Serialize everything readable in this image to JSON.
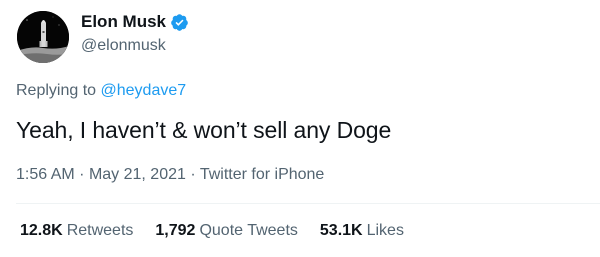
{
  "user": {
    "display_name": "Elon Musk",
    "handle": "@elonmusk",
    "verified": true
  },
  "reply": {
    "prefix": "Replying to",
    "to_handle": "@heydave7"
  },
  "tweet": {
    "text": "Yeah, I haven’t & won’t sell any Doge"
  },
  "meta": {
    "time": "1:56 AM",
    "separator": "·",
    "date": "May 21, 2021",
    "source": "Twitter for iPhone"
  },
  "stats": {
    "retweets_count": "12.8K",
    "retweets_label": "Retweets",
    "quotes_count": "1,792",
    "quotes_label": "Quote Tweets",
    "likes_count": "53.1K",
    "likes_label": "Likes"
  },
  "colors": {
    "accent": "#1d9bf0",
    "secondary_text": "#536471",
    "primary_text": "#0f1419"
  },
  "icons": {
    "verified": "verified-badge-icon",
    "avatar": "avatar"
  }
}
